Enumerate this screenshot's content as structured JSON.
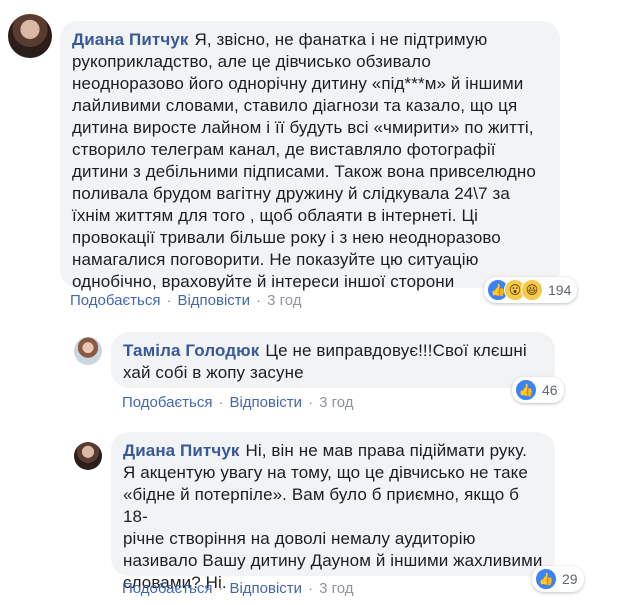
{
  "comments": [
    {
      "author": "Диана Питчук",
      "lines": [
        "Я, звісно, не фанатка і не підтримую",
        "рукоприкладство, але це дівчисько обзивало",
        "неодноразово його однорічну дитину «під***м» й іншими",
        "лайливими словами, ставило діагнози та казало, що ця",
        "дитина виросте лайном і її будуть всі «чмирити» по житті,",
        "створило телеграм канал, де виставляло фотографії",
        "дитини з дебільними підписами. Також вона привселюдно",
        "поливала брудом вагітну дружину й слідкувала 24\\7 за",
        "їхнім життям для того , щоб облаяти в інтернеті. Ці",
        "провокації тривали більше року і з нею неодноразово",
        "намагалися поговорити. Не показуйте цю ситуацію",
        "однобічно, враховуйте й інтереси іншої сторони"
      ],
      "like_label": "Подобається",
      "reply_label": "Відповісти",
      "time": "3 год",
      "reaction_count": "194",
      "reaction_icons": [
        "like-icon",
        "wow-icon",
        "haha-icon"
      ]
    },
    {
      "author": "Таміла Голодюк",
      "lines": [
        "Це не виправдовує!!!Свої клєшні",
        "хай собі в жопу засуне"
      ],
      "like_label": "Подобається",
      "reply_label": "Відповісти",
      "time": "3 год",
      "reaction_count": "46",
      "reaction_icons": [
        "like-icon"
      ]
    },
    {
      "author": "Диана Питчук",
      "lines": [
        "Ні, він не мав права підіймати руку.",
        "Я акцентую увагу на тому, що це дівчисько не таке",
        "«бідне й потерпіле». Вам було б приємно, якщо б 18-",
        "річне створіння на доволі немалу аудиторію",
        "називало Вашу дитину Дауном й іншими жахливими",
        "словами? Ні."
      ],
      "like_label": "Подобається",
      "reply_label": "Відповісти",
      "time": "3 год",
      "reaction_count": "29",
      "reaction_icons": [
        "like-icon"
      ]
    }
  ],
  "separator": "·",
  "colors": {
    "author": "#385898",
    "link": "#4267b2",
    "meta": "#90949c",
    "bubble": "#f2f3f5",
    "like": "#3b82f6"
  }
}
